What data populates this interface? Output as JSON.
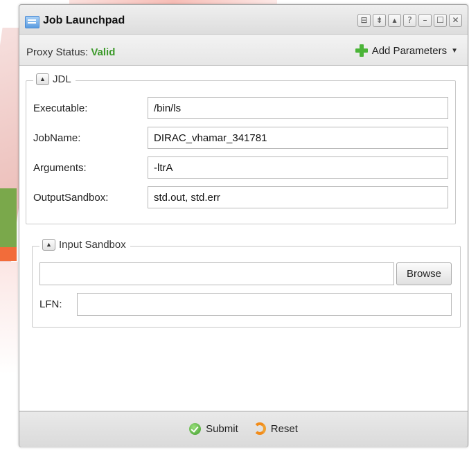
{
  "window": {
    "title": "Job Launchpad",
    "tools": [
      "⊟",
      "⇟",
      "▴",
      "?",
      "–",
      "☐",
      "✕"
    ]
  },
  "proxy": {
    "label": "Proxy Status:",
    "value": "Valid",
    "value_color": "#3d9a2b"
  },
  "add_parameters": {
    "label": "Add Parameters",
    "icon": "plus-icon"
  },
  "jdl": {
    "legend": "JDL",
    "fields": [
      {
        "label": "Executable:",
        "value": "/bin/ls"
      },
      {
        "label": "JobName:",
        "value": "DIRAC_vhamar_341781"
      },
      {
        "label": "Arguments:",
        "value": "-ltrA"
      },
      {
        "label": "OutputSandbox:",
        "value": "std.out, std.err"
      }
    ]
  },
  "input_sandbox": {
    "legend": "Input Sandbox",
    "browse_label": "Browse",
    "file_value": "",
    "lfn_label": "LFN:",
    "lfn_value": ""
  },
  "footer": {
    "submit_label": "Submit",
    "reset_label": "Reset"
  }
}
